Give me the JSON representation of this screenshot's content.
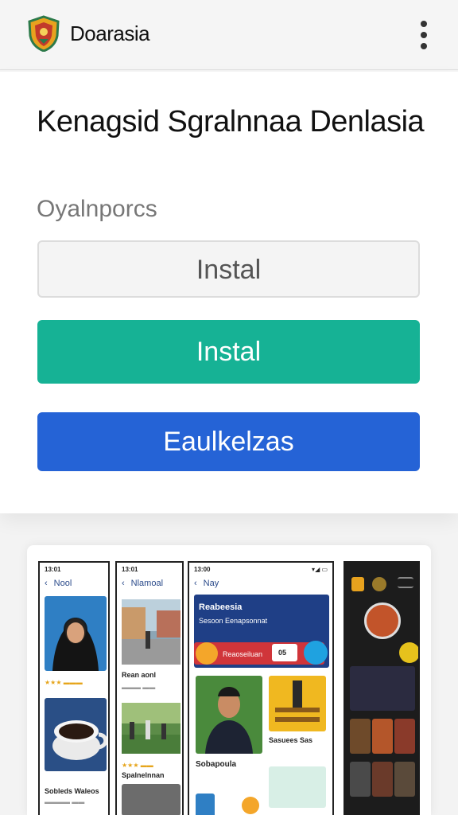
{
  "header": {
    "app_name": "Doarasia",
    "logo_icon": "shield-logo-icon",
    "menu_icon": "more-vert-icon"
  },
  "main": {
    "title": "Kenagsid Sgralnnaa Denlasia",
    "subtitle": "Oyalnporcs",
    "buttons": {
      "outline_label": "Instal",
      "primary_label": "Instal",
      "secondary_label": "Eaulkelzas"
    }
  },
  "colors": {
    "accent_green": "#16b295",
    "accent_blue": "#2563d6",
    "outline_text": "#555555"
  },
  "screenshots": [
    {
      "time": "13:01",
      "nav_title": "Nool",
      "captions": [
        "Sobleds Waleos"
      ]
    },
    {
      "time": "13:01",
      "nav_title": "Nlamoal",
      "captions": [
        "Rean aonl",
        "Spalnelnnan"
      ]
    },
    {
      "time": "13:00",
      "nav_title": "Nay",
      "banner_title": "Reabeesia",
      "banner_text": "Sesoon Eenapsonnat",
      "banner_row": "Reaoseiluan",
      "banner_value": "05",
      "captions": [
        "Sobapoula",
        "Sasuees Sas"
      ]
    },
    {
      "time": ""
    }
  ]
}
